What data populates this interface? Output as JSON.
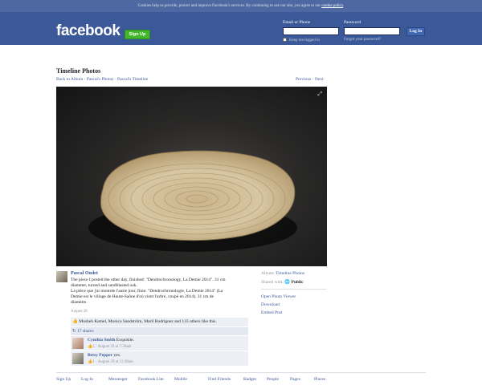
{
  "cookie_bar": {
    "text": "Cookies help us provide, protect and improve Facebook's services. By continuing to use our site, you agree to our",
    "link": "cookie policy",
    "end": "."
  },
  "header": {
    "logo": "facebook",
    "signup": "Sign Up",
    "email_label": "Email or Phone",
    "password_label": "Password",
    "keep_logged": "Keep me logged in",
    "forgot": "Forgot your password?",
    "login": "Log In"
  },
  "page": {
    "title": "Timeline Photos",
    "crumbs": {
      "back": "Back to Album",
      "sep1": " · ",
      "photos": "Pascal's Photos",
      "sep2": " · ",
      "timeline": "Pascal's Timeline"
    },
    "previous": "Previous",
    "sep": " · ",
    "next": "Next"
  },
  "meta": {
    "album_label": "Album:",
    "album_value": "Timeline Photos",
    "shared_label": "Shared with:",
    "shared_value": "Public",
    "open_viewer": "Open Photo Viewer",
    "download": "Download",
    "embed": "Embed Post"
  },
  "post": {
    "author": "Pascal Oudet",
    "line1": "The piece I posted the other day, finished: \"Dendrochronology, La Demie 2014\". 31 cm",
    "line2": "diameter, turned and sandblasted oak.",
    "line3": "La pièce que j'ai montrée l'autre jour, finie: \"Dendrochronologie, La Demie 2014\" (La",
    "line4": "Demie est le village de Haute-Saône d'où vient l'arbre, coupé en 2014). 31 cm de",
    "line5": "diamètre.",
    "date": "August 28",
    "likes": "Mosheh Kamel, Monica Sandström, Maril Rodriguez and 133 others like this.",
    "shares": "17 shares"
  },
  "comments": [
    {
      "name": "Cynthia Smith",
      "text": "Exquisite.",
      "likes": "1",
      "date": "August 29 at 7:36am"
    },
    {
      "name": "Betsy Pepper",
      "text": "yes.",
      "likes": "1",
      "date": "August 29 at 11:39am"
    }
  ],
  "footer": [
    "Sign Up",
    "Log In",
    "Messenger",
    "Facebook Lite",
    "Mobile",
    "Find Friends",
    "Badges",
    "People",
    "Pages",
    "Places"
  ]
}
